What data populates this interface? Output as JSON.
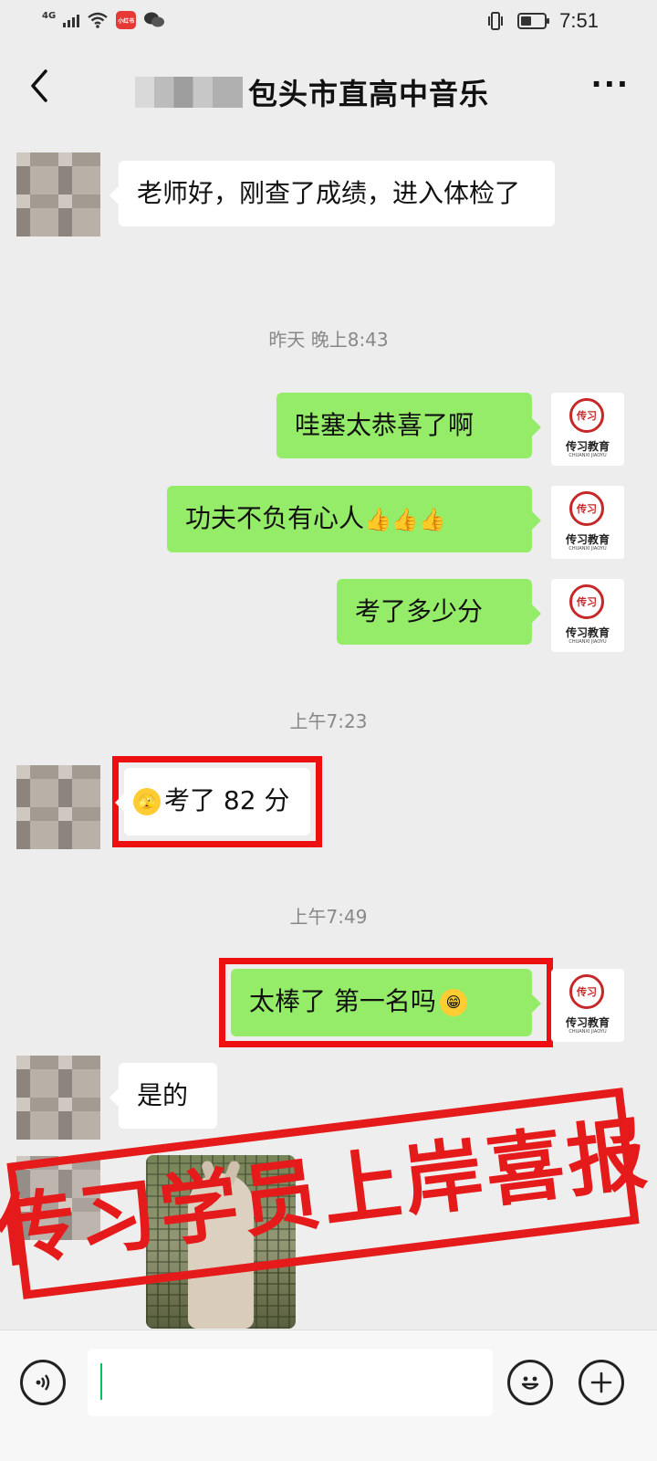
{
  "status_bar": {
    "network": "4G",
    "app_badge": "小红书",
    "time": "7:51",
    "battery_level": 0.45
  },
  "nav": {
    "title": "包头市直高中音乐",
    "more": "···"
  },
  "messages": [
    {
      "side": "in",
      "text": "老师好，刚查了成绩，进入体检了"
    },
    {
      "timestamp": "昨天 晚上8:43"
    },
    {
      "side": "out",
      "text": "哇塞太恭喜了啊"
    },
    {
      "side": "out",
      "text": "功夫不负有心人",
      "emoji": "👍👍👍"
    },
    {
      "side": "out",
      "text": "考了多少分"
    },
    {
      "timestamp": "上午7:23"
    },
    {
      "side": "in",
      "emoji": "🫣",
      "text": "考了 82 分",
      "highlighted": true
    },
    {
      "timestamp": "上午7:49"
    },
    {
      "side": "out",
      "text": "太棒了 第一名吗",
      "emoji": "😁",
      "highlighted": true
    },
    {
      "side": "in",
      "text": "是的"
    },
    {
      "side": "in",
      "type": "image"
    }
  ],
  "avatar_logo": {
    "name": "传习教育",
    "sub": "CHUANXI JIAOYU",
    "mark": "传习"
  },
  "stamp": {
    "text": "传习学员上岸喜报",
    "color": "#e51b1b"
  },
  "colors": {
    "background": "#ededed",
    "out_bubble": "#95ec69",
    "in_bubble": "#ffffff",
    "highlight": "#ee1010"
  }
}
